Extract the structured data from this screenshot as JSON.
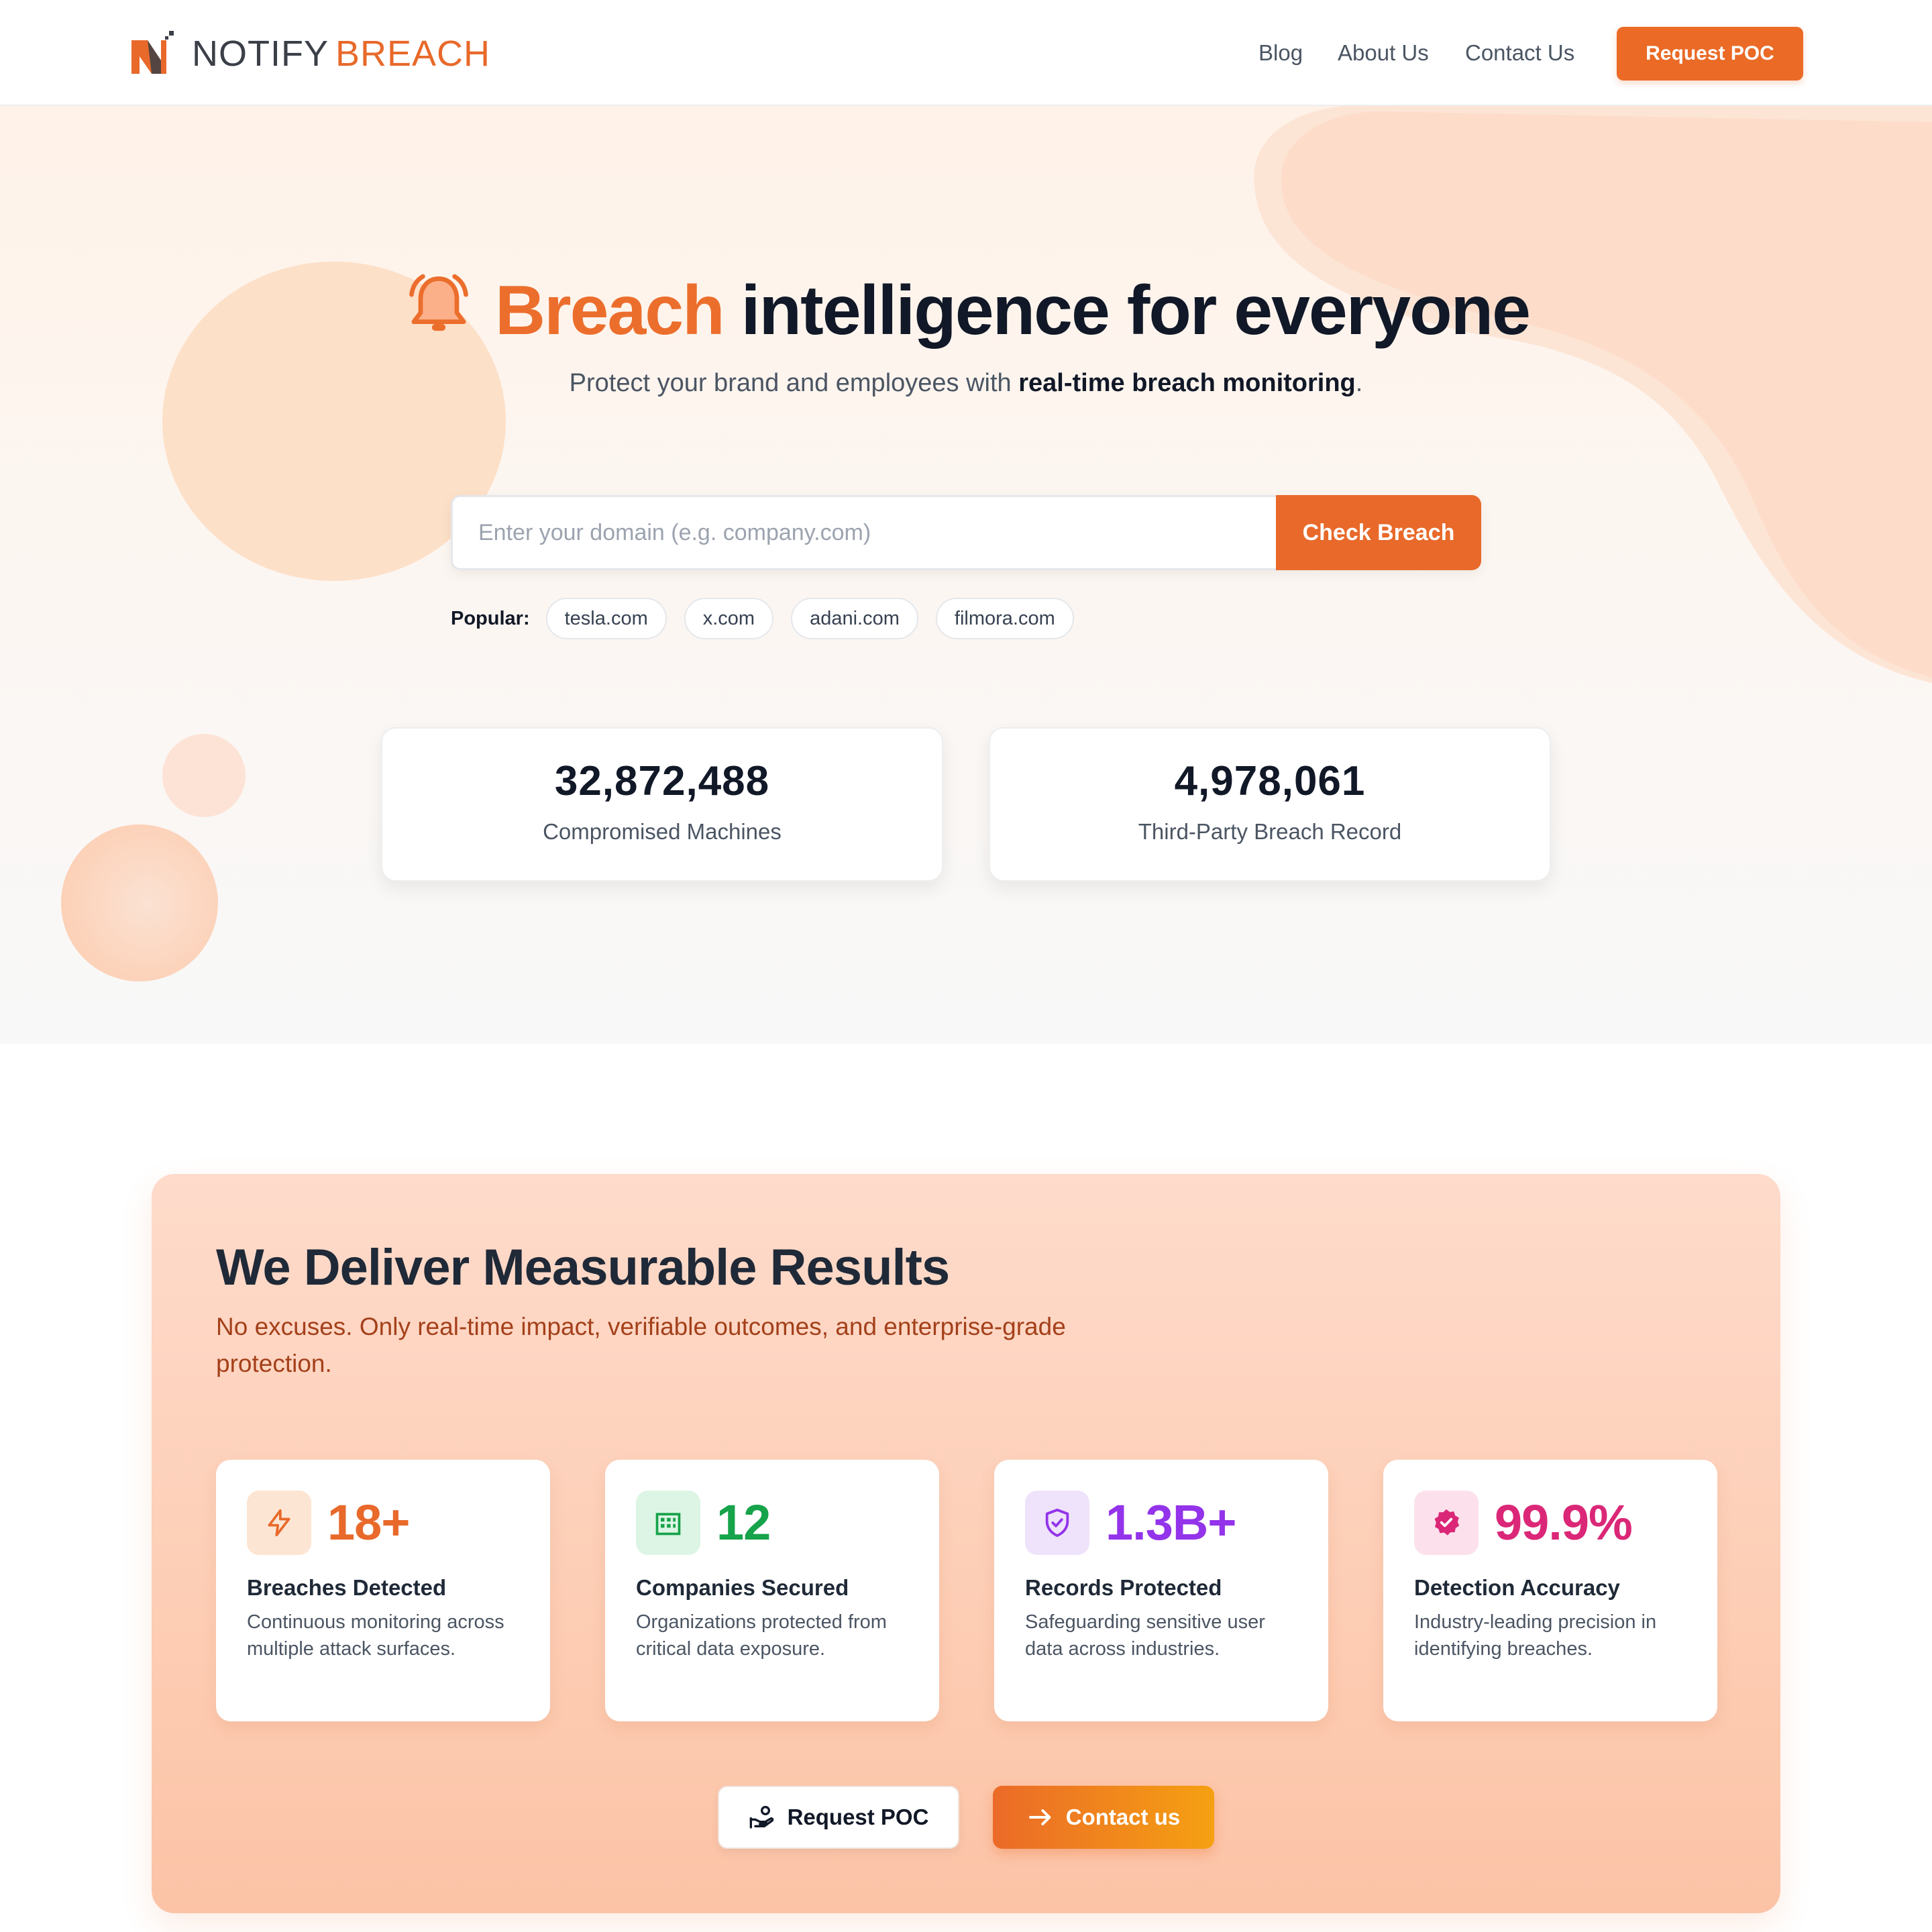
{
  "brand": {
    "name_part1": "NOTIFY",
    "name_part2": "BREACH",
    "accent_color": "#e8692a"
  },
  "nav": {
    "links": [
      "Blog",
      "About Us",
      "Contact Us"
    ],
    "cta_label": "Request POC"
  },
  "hero": {
    "title_accent": "Breach",
    "title_rest": "intelligence for everyone",
    "subtitle_pre": "Protect your brand and employees with ",
    "subtitle_bold": "real-time breach monitoring",
    "subtitle_post": ".",
    "search": {
      "placeholder": "Enter your domain (e.g. company.com)",
      "value": "",
      "button_label": "Check Breach"
    },
    "popular_label": "Popular:",
    "popular_domains": [
      "tesla.com",
      "x.com",
      "adani.com",
      "filmora.com"
    ],
    "stats": [
      {
        "value": "32,872,488",
        "label": "Compromised Machines"
      },
      {
        "value": "4,978,061",
        "label": "Third-Party Breach Record"
      }
    ]
  },
  "results": {
    "title": "We Deliver Measurable Results",
    "subtitle": "No excuses. Only real-time impact, verifiable outcomes, and enterprise-grade protection.",
    "cards": [
      {
        "icon": "lightning-icon",
        "value": "18+",
        "title": "Breaches Detected",
        "description": "Continuous monitoring across multiple attack surfaces.",
        "color": "#e8692a",
        "icon_bg": "#fde5d3"
      },
      {
        "icon": "building-icon",
        "value": "12",
        "title": "Companies Secured",
        "description": "Organizations protected from critical data exposure.",
        "color": "#16a34a",
        "icon_bg": "#dcf5e4"
      },
      {
        "icon": "shield-check-icon",
        "value": "1.3B+",
        "title": "Records Protected",
        "description": "Safeguarding sensitive user data across industries.",
        "color": "#9333ea",
        "icon_bg": "#efe3fb"
      },
      {
        "icon": "verified-badge-icon",
        "value": "99.9%",
        "title": "Detection Accuracy",
        "description": "Industry-leading precision in identifying breaches.",
        "color": "#db2777",
        "icon_bg": "#fce1ec"
      }
    ],
    "primary_button": "Request POC",
    "secondary_button": "Contact us"
  }
}
